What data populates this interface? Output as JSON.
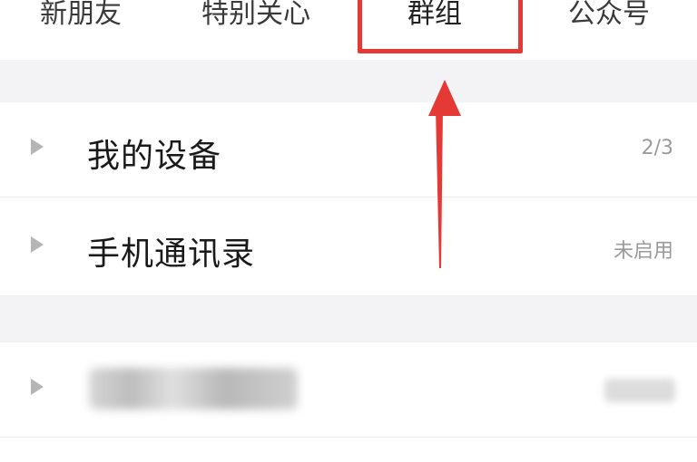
{
  "tabs": [
    {
      "label": "新朋友"
    },
    {
      "label": "特别关心"
    },
    {
      "label": "群组"
    },
    {
      "label": "公众号"
    }
  ],
  "list": {
    "items": [
      {
        "title": "我的设备",
        "meta": "2/3"
      },
      {
        "title": "手机通讯录",
        "meta": "未启用"
      },
      {
        "title": "",
        "meta": ""
      }
    ]
  },
  "colors": {
    "annotation": "#e53935",
    "separator": "#f3f3f5",
    "muted_text": "#9a9a9a"
  },
  "icons": [
    "expand-caret-icon",
    "annotation-arrow-icon"
  ]
}
